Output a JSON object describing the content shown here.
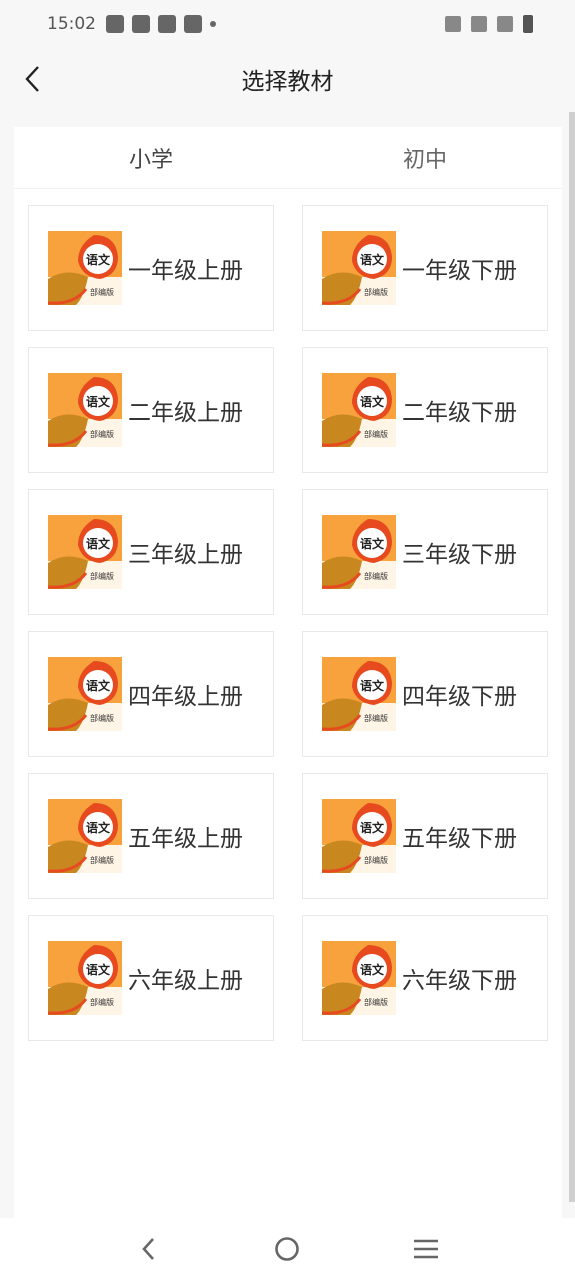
{
  "status_bar": {
    "time": "15:02"
  },
  "header": {
    "title": "选择教材"
  },
  "tabs": [
    {
      "label": "小学"
    },
    {
      "label": "初中"
    }
  ],
  "cover": {
    "subject": "语文",
    "edition": "部编版"
  },
  "books": [
    {
      "label": "一年级上册"
    },
    {
      "label": "一年级下册"
    },
    {
      "label": "二年级上册"
    },
    {
      "label": "二年级下册"
    },
    {
      "label": "三年级上册"
    },
    {
      "label": "三年级下册"
    },
    {
      "label": "四年级上册"
    },
    {
      "label": "四年级下册"
    },
    {
      "label": "五年级上册"
    },
    {
      "label": "五年级下册"
    },
    {
      "label": "六年级上册"
    },
    {
      "label": "六年级下册"
    }
  ],
  "colors": {
    "cover_orange": "#f7a23c",
    "cover_red": "#e64a1e",
    "cover_brown": "#c9871f"
  }
}
